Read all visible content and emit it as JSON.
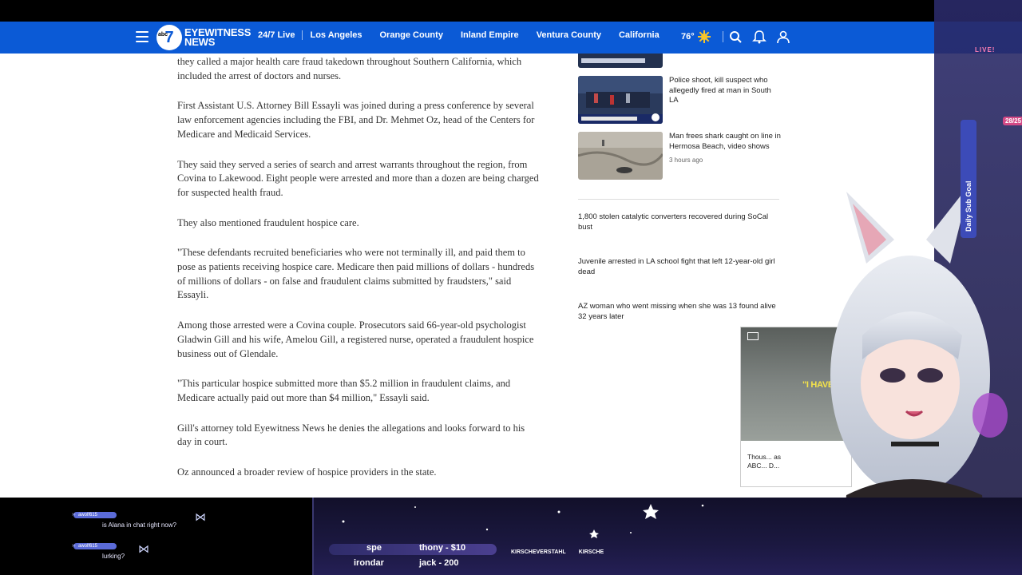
{
  "nav": {
    "logo_text_1": "EYEWITNESS",
    "logo_text_2": "NEWS",
    "logo_number": "7",
    "logo_abc": "abc",
    "links": [
      "24/7 Live",
      "Los Angeles",
      "Orange County",
      "Inland Empire",
      "Ventura County",
      "California"
    ],
    "temperature": "76°"
  },
  "article": {
    "paragraphs": [
      "they called a major health care fraud takedown throughout Southern California, which included the arrest of doctors and nurses.",
      "First Assistant U.S. Attorney Bill Essayli was joined during a press conference by several law enforcement agencies including the FBI, and Dr. Mehmet Oz, head of the Centers for Medicare and Medicaid Services.",
      "They said they served a series of search and arrest warrants throughout the region, from Covina to Lakewood. Eight people were arrested and more than a dozen are being charged for suspected health fraud.",
      "They also mentioned fraudulent hospice care.",
      "\"These defendants recruited beneficiaries who were not terminally ill, and paid them to pose as patients receiving hospice care. Medicare then paid millions of dollars - hundreds of millions of dollars - on false and fraudulent claims submitted by fraudsters,\" said Essayli.",
      "Among those arrested were a Covina couple. Prosecutors said 66-year-old psychologist Gladwin Gill and his wife, Amelou Gill, a registered nurse, operated a fraudulent hospice business out of Glendale.",
      "\"This particular hospice submitted more than $5.2 million in fraudulent claims, and Medicare actually paid out more than $4 million,\" Essayli said.",
      "Gill's attorney told Eyewitness News he denies the allegations and looks forward to his day in court.",
      "Oz announced a broader review of hospice providers in the state."
    ]
  },
  "sidebar": {
    "stories": [
      {
        "headline": "Police shoot, kill suspect who allegedly fired at man in South LA",
        "time": ""
      },
      {
        "headline": "Man frees shark caught on line in Hermosa Beach, video shows",
        "time": "3 hours ago"
      }
    ],
    "text_stories": [
      "1,800 stolen catalytic converters recovered during SoCal bust",
      "Juvenile arrested in LA school fight that left 12-year-old girl dead",
      "AZ woman who went missing when she was 13 found alive 32 years later"
    ]
  },
  "minivideo": {
    "overlay_text": "\"I HAVE A",
    "caption": "Thous... as ABC... D..."
  },
  "stream": {
    "chat": [
      {
        "user": "awolf615",
        "text": "is Alana in chat right now?"
      },
      {
        "user": "awolf615",
        "text": "lurking?"
      }
    ],
    "ticker": [
      {
        "text": "spe",
        "row": 1
      },
      {
        "text": "thony - $10",
        "row": 1
      },
      {
        "text": "irondar",
        "row": 2
      },
      {
        "text": "jack - 200",
        "row": 2
      }
    ],
    "socials": [
      "KIRSCHEVERSTAHL",
      "KIRSCHE"
    ],
    "goal_label": "Daily Sub Goal",
    "goal_count": "28/25",
    "live_label": "LIVE!"
  },
  "colors": {
    "nav_bg": "#0b5ad6",
    "overlay_bg": "#1b1840"
  }
}
